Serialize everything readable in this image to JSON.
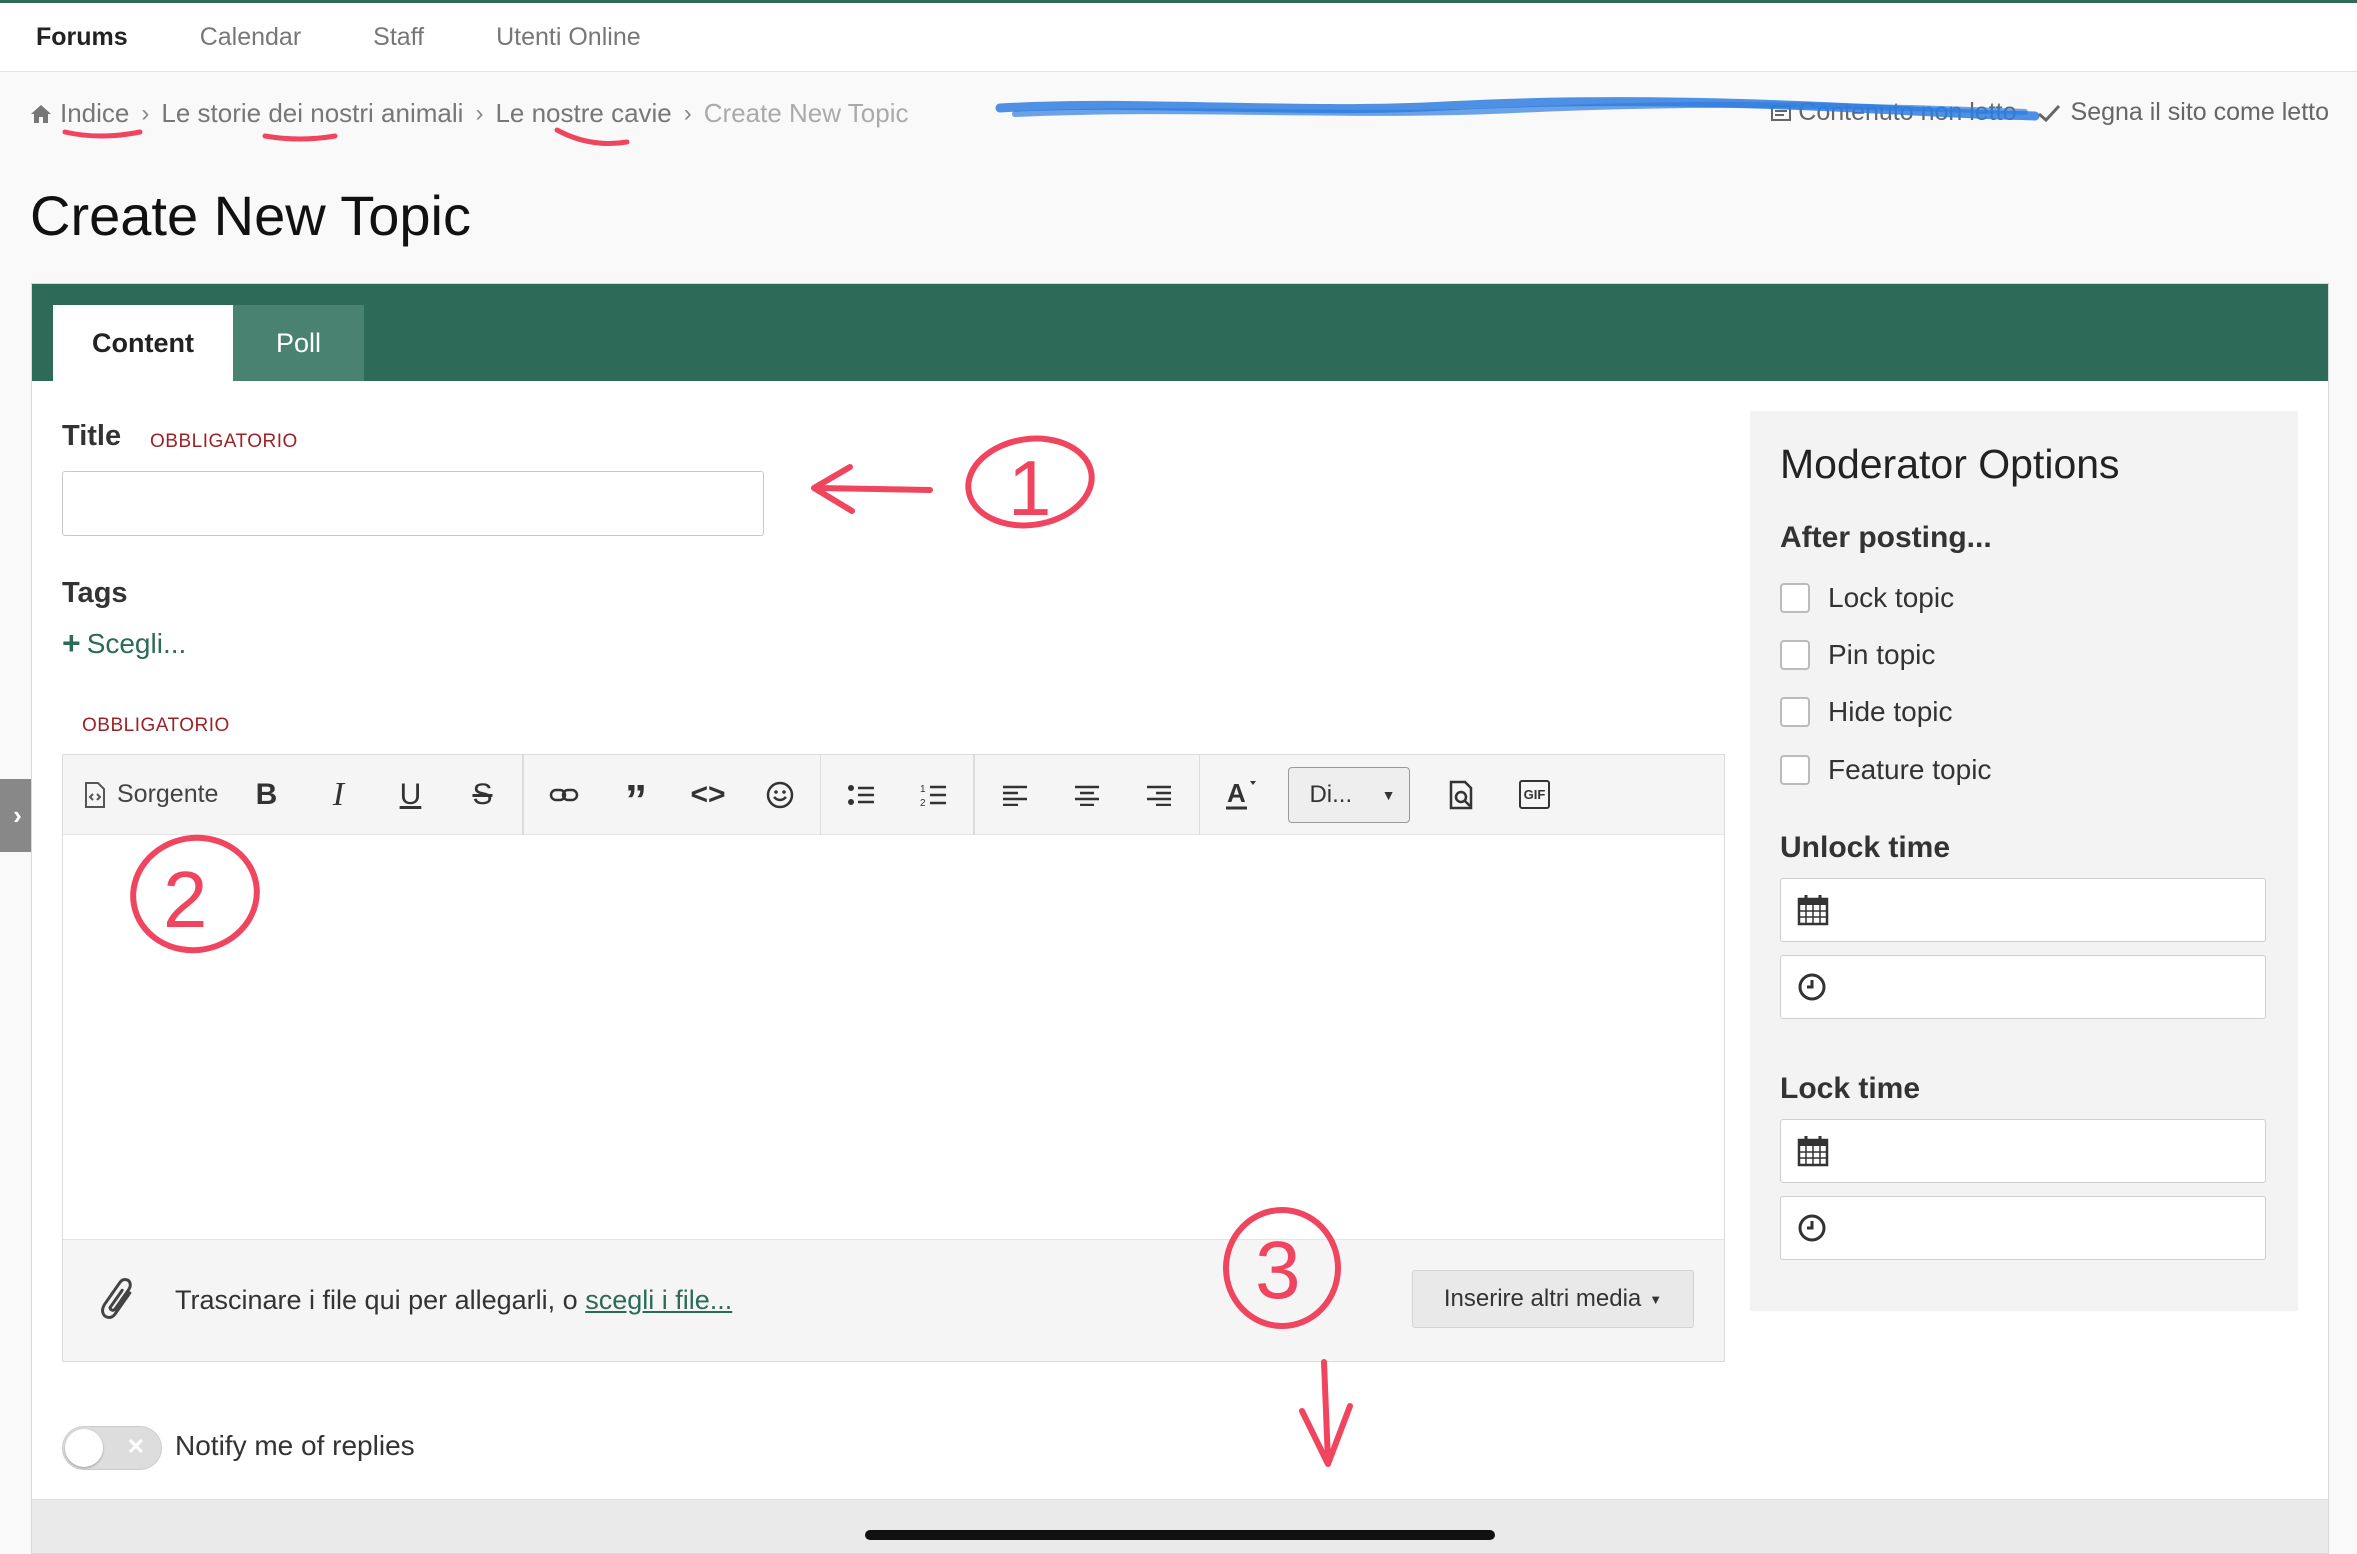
{
  "nav": {
    "items": [
      "Forums",
      "Calendar",
      "Staff",
      "Utenti Online"
    ],
    "active": "Forums"
  },
  "breadcrumb": {
    "items": [
      "Indice",
      "Le storie dei nostri animali",
      "Le nostre cavie"
    ],
    "current": "Create New Topic",
    "unread_label": "Contenuto non letto",
    "mark_read_label": "Segna il sito come letto"
  },
  "page": {
    "title": "Create New Topic"
  },
  "tabs": {
    "content": "Content",
    "poll": "Poll"
  },
  "form": {
    "title_label": "Title",
    "required_label": "OBBLIGATORIO",
    "tags_label": "Tags",
    "tags_choose": "Scegli...",
    "editor_required": "OBBLIGATORIO",
    "source_label": "Sorgente",
    "format_select": "Di...",
    "gif_label": "GIF",
    "attach_text": "Trascinare i file qui per allegarli, o ",
    "attach_link": "scegli i file...",
    "media_button": "Inserire altri media",
    "notify_label": "Notify me of replies"
  },
  "moderator": {
    "title": "Moderator Options",
    "after_posting": "After posting...",
    "options": [
      "Lock topic",
      "Pin topic",
      "Hide topic",
      "Feature topic"
    ],
    "unlock_time": "Unlock time",
    "lock_time": "Lock time"
  },
  "annotations": [
    "1",
    "2",
    "3"
  ],
  "colors": {
    "brand": "#2d6a58",
    "required": "#9b2226",
    "annotation": "#f0455f",
    "scribble": "#2f7ee0"
  }
}
